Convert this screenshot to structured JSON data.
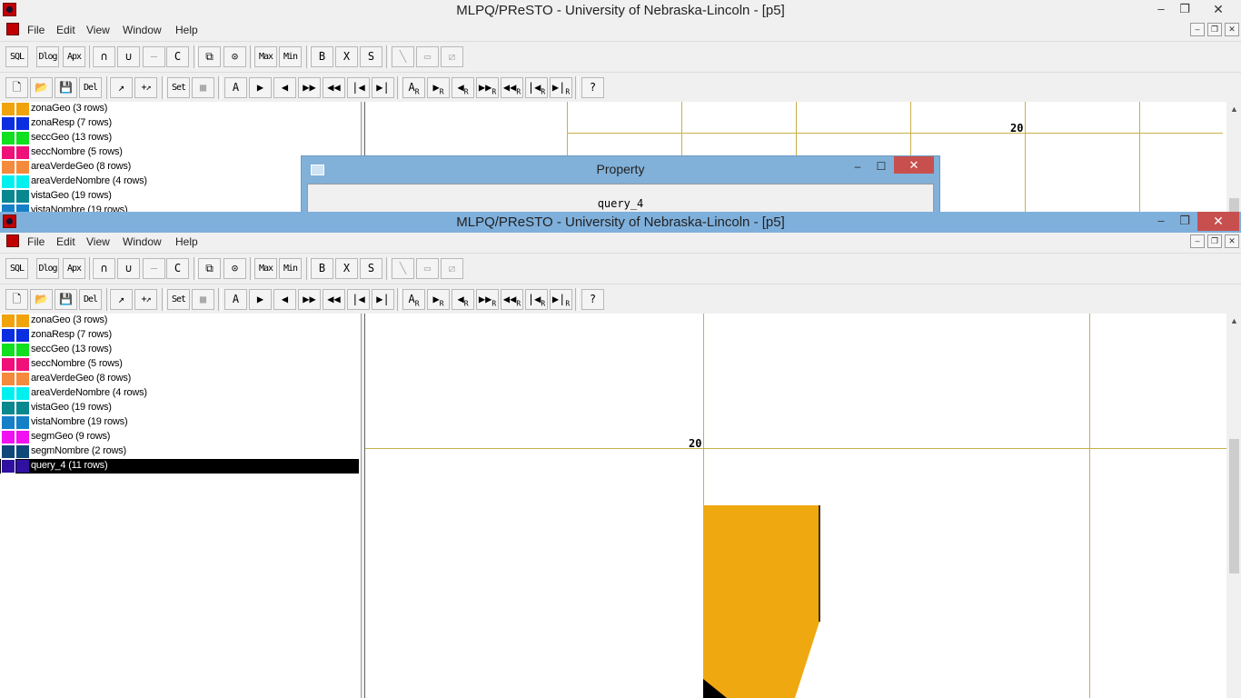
{
  "app_title": "MLPQ/PReSTO - University of Nebraska-Lincoln - [p5]",
  "window_controls": {
    "minimize": "–",
    "maximize": "❐",
    "close": "✕"
  },
  "menu": [
    "File",
    "Edit",
    "View",
    "Window",
    "Help"
  ],
  "mdi_controls": {
    "minimize": "–",
    "restore": "❐",
    "close": "✕"
  },
  "toolbar1": [
    "SQL",
    "Dlog",
    "Apx",
    "∩",
    "∪",
    "—",
    "C",
    "⧉",
    "⊙",
    "Max",
    "Min",
    "B",
    "X",
    "S",
    "╲",
    "▭",
    "⧄"
  ],
  "toolbar2": [
    "🗋",
    "📂",
    "💾",
    "Del",
    "↗",
    "+↗",
    "Set",
    "■",
    "A",
    "▶",
    "◀",
    "▶▶",
    "◀◀",
    "|◀",
    "▶|",
    "A",
    "▶",
    "◀",
    "▶▶",
    "◀◀",
    "|◀",
    "▶|",
    "?"
  ],
  "toolbar2_sub": "R",
  "layers": [
    {
      "name": "zonaGeo (3 rows)",
      "color": "#f0a30a"
    },
    {
      "name": "zonaResp (7 rows)",
      "color": "#0a2ee0"
    },
    {
      "name": "seccGeo (13 rows)",
      "color": "#10e020"
    },
    {
      "name": "seccNombre (5 rows)",
      "color": "#f0107a"
    },
    {
      "name": "areaVerdeGeo (8 rows)",
      "color": "#f58a3c"
    },
    {
      "name": "areaVerdeNombre (4 rows)",
      "color": "#00f0f0"
    },
    {
      "name": "vistaGeo (19 rows)",
      "color": "#0a8890"
    },
    {
      "name": "vistaNombre (19 rows)",
      "color": "#1580c8"
    },
    {
      "name": "segmGeo (9 rows)",
      "color": "#f010f0"
    },
    {
      "name": "segmNombre (2 rows)",
      "color": "#10487a"
    },
    {
      "name": "query_4 (11 rows)",
      "color": "#3010a0"
    }
  ],
  "background_window": {
    "visible_layers": [
      "zonaGeo (3 rows)",
      "zonaResp (7 rows)",
      "seccGeo (13 rows)",
      "seccNombre (5 rows)",
      "areaVerdeGeo (8 rows)",
      "areaVerdeNombre (4 rows)",
      "vistaGeo (19 rows)",
      "vistaNombre (19 rows)"
    ],
    "axis_label": "20"
  },
  "map": {
    "axis_label": "20",
    "shape_color": "#f0a810",
    "grid_color": "#c8b04a"
  },
  "dialog": {
    "title": "Property",
    "body": "query_4",
    "minimize": "–",
    "maximize": "☐",
    "close": "✕"
  },
  "scroll": {
    "up": "▲"
  }
}
